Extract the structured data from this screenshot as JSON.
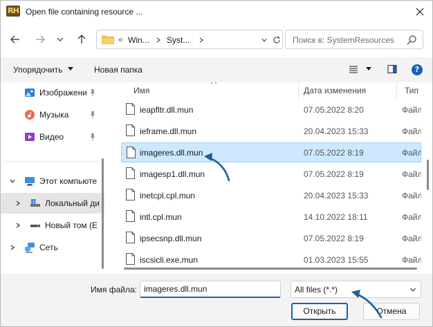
{
  "window": {
    "app_icon_text": "RH",
    "title": "Open file containing resource ..."
  },
  "nav": {
    "breadcrumb": [
      "Win...",
      "Syst..."
    ],
    "breadcrumb_prefix": "«",
    "search_placeholder": "Поиск в: SystemResources"
  },
  "toolbar": {
    "organize_label": "Упорядочить",
    "new_folder_label": "Новая папка",
    "help_label": "?"
  },
  "sidebar": {
    "items": [
      {
        "label": "Изображени",
        "icon": "pictures-icon",
        "pinned": true
      },
      {
        "label": "Музыка",
        "icon": "music-icon",
        "pinned": true
      },
      {
        "label": "Видео",
        "icon": "video-icon",
        "pinned": true
      },
      {
        "label": "Этот компьюте",
        "icon": "computer-icon",
        "expanded": true
      },
      {
        "label": "Локальный ди",
        "icon": "local-disk-icon",
        "selected": true
      },
      {
        "label": "Новый том (E",
        "icon": "volume-icon"
      },
      {
        "label": "Сеть",
        "icon": "network-icon"
      }
    ]
  },
  "columns": {
    "name": "Имя",
    "date": "Дата изменения",
    "type": "Тип"
  },
  "files": [
    {
      "name": "ieapfltr.dll.mun",
      "date": "07.05.2022 8:20",
      "type": "Файл"
    },
    {
      "name": "ieframe.dll.mun",
      "date": "20.04.2023 15:33",
      "type": "Файл"
    },
    {
      "name": "imageres.dll.mun",
      "date": "07.05.2022 8:19",
      "type": "Файл",
      "selected": true
    },
    {
      "name": "imagesp1.dll.mun",
      "date": "07.05.2022 8:19",
      "type": "Файл"
    },
    {
      "name": "inetcpl.cpl.mun",
      "date": "20.04.2023 15:33",
      "type": "Файл"
    },
    {
      "name": "intl.cpl.mun",
      "date": "14.10.2022 18:11",
      "type": "Файл"
    },
    {
      "name": "ipsecsnp.dll.mun",
      "date": "07.05.2022 8:19",
      "type": "Файл"
    },
    {
      "name": "iscsicli.exe.mun",
      "date": "01.03.2023 15:55",
      "type": "Файл"
    }
  ],
  "bottom": {
    "filename_label": "Имя файла:",
    "filename_value": "imageres.dll.mun",
    "filter_value": "All files (*.*)",
    "open_label": "Открыть",
    "cancel_label": "Отмена"
  },
  "colors": {
    "accent": "#1a5fb4",
    "selection_bg": "#cde8ff",
    "selection_border": "#99d1ff",
    "annotation_arrow": "#1f5f95"
  }
}
